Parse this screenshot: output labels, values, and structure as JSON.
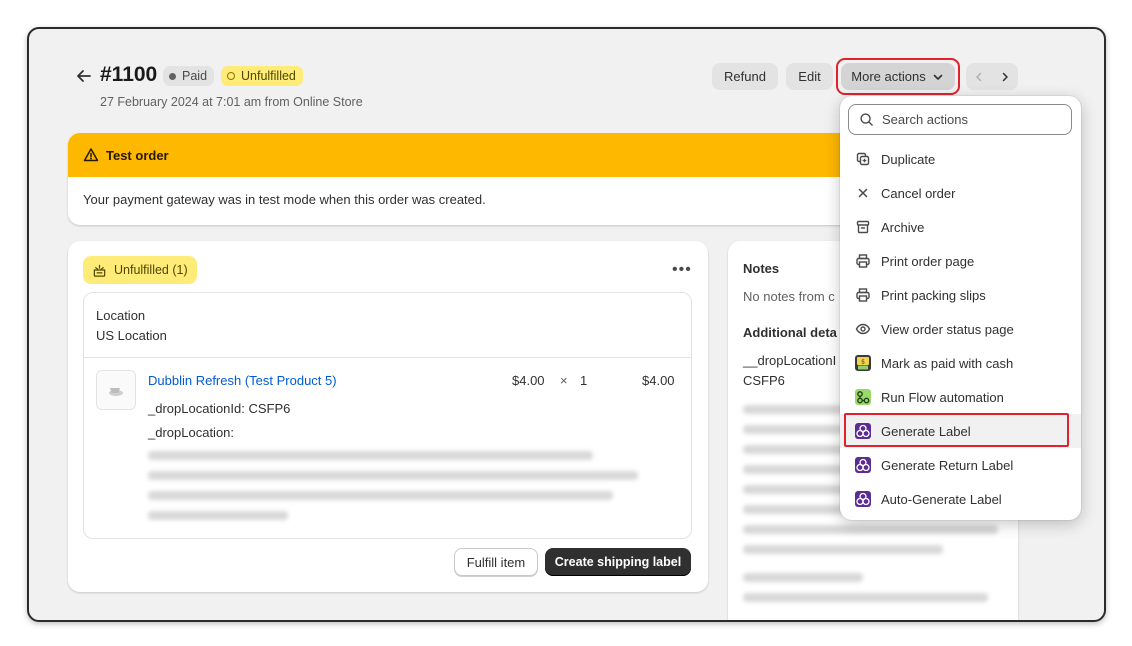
{
  "order": {
    "title": "#1100",
    "paid_badge": "Paid",
    "unfulfilled_badge": "Unfulfilled",
    "subtitle": "27 February 2024 at 7:01 am from Online Store"
  },
  "header": {
    "refund": "Refund",
    "edit": "Edit",
    "more_actions": "More actions"
  },
  "test_banner": {
    "title": "Test order",
    "message": "Your payment gateway was in test mode when this order was created."
  },
  "fulfillment": {
    "badge": "Unfulfilled (1)",
    "location_label": "Location",
    "location_value": "US Location",
    "product_name": "Dubblin Refresh (Test Product 5)",
    "price": "$4.00",
    "times": "×",
    "quantity": "1",
    "total": "$4.00",
    "prop1": "_dropLocationId: CSFP6",
    "prop2": "_dropLocation:",
    "fulfill_button": "Fulfill item",
    "shipping_button": "Create shipping label"
  },
  "notes": {
    "title": "Notes",
    "empty": "No notes from c",
    "additional_title": "Additional deta",
    "key": "__dropLocationI",
    "value": "CSFP6"
  },
  "dropdown": {
    "search_placeholder": "Search actions",
    "items": [
      {
        "label": "Duplicate",
        "icon": "duplicate-icon"
      },
      {
        "label": "Cancel order",
        "icon": "close-icon"
      },
      {
        "label": "Archive",
        "icon": "archive-icon"
      },
      {
        "label": "Print order page",
        "icon": "printer-icon"
      },
      {
        "label": "Print packing slips",
        "icon": "printer-icon"
      },
      {
        "label": "View order status page",
        "icon": "eye-icon"
      },
      {
        "label": "Mark as paid with cash",
        "icon": "cash-app-icon"
      },
      {
        "label": "Run Flow automation",
        "icon": "flow-app-icon"
      },
      {
        "label": "Generate Label",
        "icon": "label-app-icon"
      },
      {
        "label": "Generate Return Label",
        "icon": "label-app-icon"
      },
      {
        "label": "Auto-Generate Label",
        "icon": "label-app-icon"
      }
    ]
  },
  "colors": {
    "warning": "#ffb800",
    "badge_yellow": "#ffeb78",
    "link": "#005bd3",
    "highlight": "#e0212e",
    "app_purple": "#5c2d91"
  }
}
